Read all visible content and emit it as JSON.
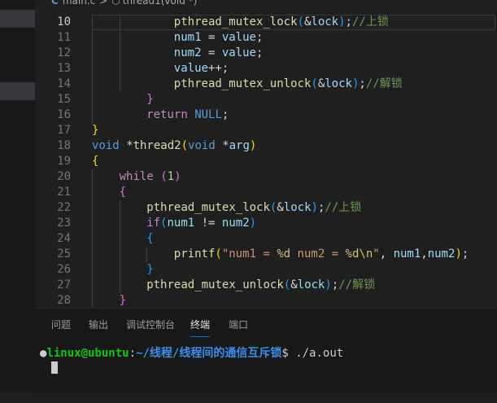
{
  "breadcrumb": {
    "file_icon": "C",
    "file": "main.c",
    "separator": ">",
    "symbol_icon": "function-icon",
    "symbol": "thread1(void *)"
  },
  "editor": {
    "lines": [
      {
        "n": "10",
        "tokens": [
          [
            "pthread_mutex_lock",
            "fn"
          ],
          [
            "(",
            "b3"
          ],
          [
            "&",
            "op"
          ],
          [
            "lock",
            "var"
          ],
          [
            ")",
            "b3"
          ],
          [
            ";",
            "op"
          ],
          [
            "//上锁",
            "cmt"
          ]
        ]
      },
      {
        "n": "11",
        "tokens": [
          [
            "num1",
            "var"
          ],
          [
            " = ",
            "op"
          ],
          [
            "value",
            "var"
          ],
          [
            ";",
            "op"
          ]
        ]
      },
      {
        "n": "12",
        "tokens": [
          [
            "num2",
            "var"
          ],
          [
            " = ",
            "op"
          ],
          [
            "value",
            "var"
          ],
          [
            ";",
            "op"
          ]
        ]
      },
      {
        "n": "13",
        "tokens": [
          [
            "value",
            "var"
          ],
          [
            "++;",
            "op"
          ]
        ]
      },
      {
        "n": "14",
        "tokens": [
          [
            "pthread_mutex_unlock",
            "fn"
          ],
          [
            "(",
            "b3"
          ],
          [
            "&",
            "op"
          ],
          [
            "lock",
            "var"
          ],
          [
            ")",
            "b3"
          ],
          [
            ";",
            "op"
          ],
          [
            "//解锁",
            "cmt"
          ]
        ]
      },
      {
        "n": "15",
        "tokens": [
          [
            "}",
            "b2"
          ]
        ]
      },
      {
        "n": "16",
        "tokens": [
          [
            "return",
            "ctrl"
          ],
          [
            " ",
            "op"
          ],
          [
            "NULL",
            "kw"
          ],
          [
            ";",
            "op"
          ]
        ]
      },
      {
        "n": "17",
        "tokens": [
          [
            "}",
            "b1"
          ]
        ]
      },
      {
        "n": "18",
        "tokens": [
          [
            "void",
            "kw"
          ],
          [
            " *",
            "op"
          ],
          [
            "thread2",
            "fn"
          ],
          [
            "(",
            "b1"
          ],
          [
            "void",
            "kw"
          ],
          [
            " *",
            "op"
          ],
          [
            "arg",
            "var"
          ],
          [
            ")",
            "b1"
          ]
        ]
      },
      {
        "n": "19",
        "tokens": [
          [
            "{",
            "b1"
          ]
        ]
      },
      {
        "n": "20",
        "tokens": [
          [
            "while",
            "ctrl"
          ],
          [
            " ",
            "op"
          ],
          [
            "(",
            "b2"
          ],
          [
            "1",
            "num"
          ],
          [
            ")",
            "b2"
          ]
        ]
      },
      {
        "n": "21",
        "tokens": [
          [
            "{",
            "b2"
          ]
        ]
      },
      {
        "n": "22",
        "tokens": [
          [
            "pthread_mutex_lock",
            "fn"
          ],
          [
            "(",
            "b3"
          ],
          [
            "&",
            "op"
          ],
          [
            "lock",
            "var"
          ],
          [
            ")",
            "b3"
          ],
          [
            ";",
            "op"
          ],
          [
            "//上锁",
            "cmt"
          ]
        ]
      },
      {
        "n": "23",
        "tokens": [
          [
            "if",
            "ctrl"
          ],
          [
            "(",
            "b3"
          ],
          [
            "num1",
            "var"
          ],
          [
            " != ",
            "op"
          ],
          [
            "num2",
            "var"
          ],
          [
            ")",
            "b3"
          ]
        ]
      },
      {
        "n": "24",
        "tokens": [
          [
            "{",
            "b3"
          ]
        ]
      },
      {
        "n": "25",
        "tokens": [
          [
            "printf",
            "fn"
          ],
          [
            "(",
            "b1"
          ],
          [
            "\"num1 = ",
            "str"
          ],
          [
            "%d",
            "esc"
          ],
          [
            " num2 = ",
            "str"
          ],
          [
            "%d",
            "esc"
          ],
          [
            "\\n",
            "esc"
          ],
          [
            "\"",
            "str"
          ],
          [
            ", ",
            "op"
          ],
          [
            "num1",
            "var"
          ],
          [
            ",",
            "op"
          ],
          [
            "num2",
            "var"
          ],
          [
            ")",
            "b1"
          ],
          [
            ";",
            "op"
          ]
        ]
      },
      {
        "n": "26",
        "tokens": [
          [
            "}",
            "b3"
          ]
        ]
      },
      {
        "n": "27",
        "tokens": [
          [
            "pthread_mutex_unlock",
            "fn"
          ],
          [
            "(",
            "b3"
          ],
          [
            "&",
            "op"
          ],
          [
            "lock",
            "var"
          ],
          [
            ")",
            "b3"
          ],
          [
            ";",
            "op"
          ],
          [
            "//解锁",
            "cmt"
          ]
        ]
      },
      {
        "n": "28",
        "tokens": [
          [
            "}",
            "b2"
          ]
        ]
      }
    ]
  },
  "panel": {
    "tabs": [
      "问题",
      "输出",
      "调试控制台",
      "终端",
      "端口"
    ],
    "active_tab": "终端"
  },
  "terminal": {
    "indicator": "●",
    "user_host": "linux@ubuntu",
    "colon": ":",
    "path": "~/线程/线程间的通信互斥锁",
    "prompt_symbol": "$",
    "command": " ./a.out"
  }
}
